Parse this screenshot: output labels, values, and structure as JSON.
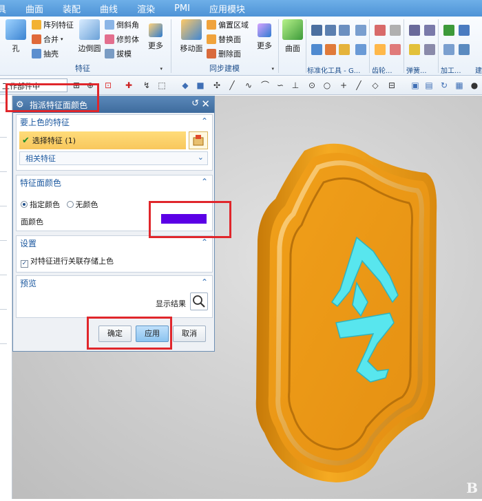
{
  "menubar": {
    "items": [
      "具",
      "曲面",
      "装配",
      "曲线",
      "渲染",
      "PMI",
      "应用模块"
    ]
  },
  "ribbon": {
    "feature_group": {
      "hole_label": "孔",
      "pattern_label": "阵列特征",
      "unite_label": "合并",
      "shell_label": "抽壳",
      "edge_blend_label": "边倒圆",
      "chamfer_label": "倒斜角",
      "trim_body_label": "修剪体",
      "draft_label": "拔模",
      "more_label": "更多",
      "group_label": "特征"
    },
    "sync_group": {
      "move_face_label": "移动面",
      "offset_region_label": "偏置区域",
      "replace_face_label": "替换面",
      "delete_face_label": "删除面",
      "more_label": "更多",
      "group_label": "同步建模"
    },
    "surface_group": {
      "surface_label": "曲面"
    },
    "tail_labels": [
      "标准化工具 - G...",
      "齿轮...",
      "弹簧...",
      "加工...",
      "建"
    ]
  },
  "toolbar": {
    "combo_value": "工作部件中"
  },
  "dialog": {
    "title": "指派特征面颜色",
    "section_feature": {
      "title": "要上色的特征",
      "select_label": "选择特征 (1)",
      "related_label": "相关特征"
    },
    "section_color": {
      "title": "特征面颜色",
      "radio_specify": "指定颜色",
      "radio_none": "无颜色",
      "face_color_label": "面颜色",
      "swatch_color": "#5b00e6"
    },
    "section_settings": {
      "title": "设置",
      "checkbox_label": "对特征进行关联存储上色"
    },
    "section_preview": {
      "title": "预览",
      "show_result_label": "显示结果"
    },
    "buttons": {
      "ok": "确定",
      "apply": "应用",
      "cancel": "取消"
    }
  },
  "viewport": {
    "watermark": "B",
    "model_colors": {
      "body": "#f0a41c",
      "engraving": "#58e6ee"
    }
  }
}
